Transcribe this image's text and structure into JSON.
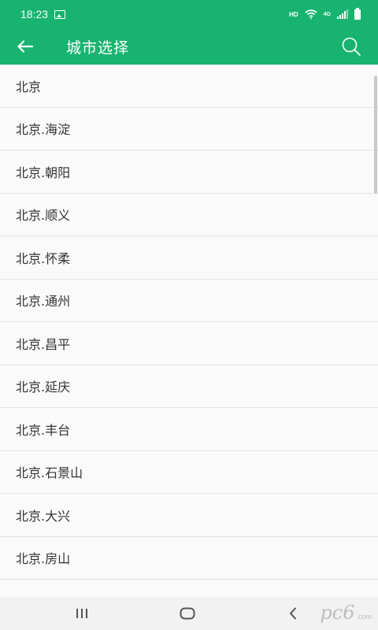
{
  "status_bar": {
    "time": "18:23",
    "hd": "HD",
    "network": "4G"
  },
  "app_bar": {
    "title": "城市选择",
    "back_icon": "arrow-left-icon",
    "search_icon": "search-icon"
  },
  "cities": [
    {
      "label": "北京"
    },
    {
      "label": "北京.海淀"
    },
    {
      "label": "北京.朝阳"
    },
    {
      "label": "北京.顺义"
    },
    {
      "label": "北京.怀柔"
    },
    {
      "label": "北京.通州"
    },
    {
      "label": "北京.昌平"
    },
    {
      "label": "北京.延庆"
    },
    {
      "label": "北京.丰台"
    },
    {
      "label": "北京.石景山"
    },
    {
      "label": "北京.大兴"
    },
    {
      "label": "北京.房山"
    }
  ],
  "watermark": {
    "text": "pc6",
    "sub": ".com"
  },
  "colors": {
    "accent": "#18b46f"
  }
}
